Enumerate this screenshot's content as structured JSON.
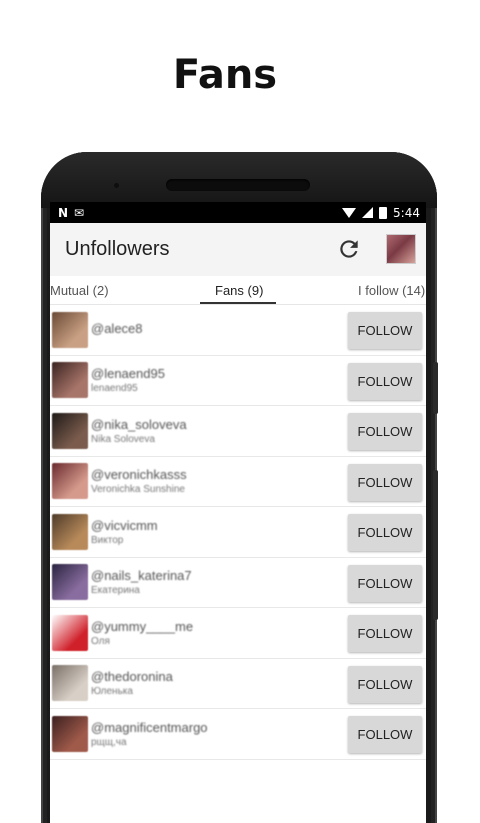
{
  "promo": {
    "title": "Fans"
  },
  "statusbar": {
    "left_icons": [
      "N",
      "✉"
    ],
    "time": "5:44"
  },
  "appbar": {
    "title": "Unfollowers",
    "refresh_icon": "refresh-icon"
  },
  "tabs": [
    {
      "label": "Mutual (2)",
      "selected": false
    },
    {
      "label": "Fans (9)",
      "selected": true
    },
    {
      "label": "I follow (14)",
      "selected": false
    }
  ],
  "follow_label": "FOLLOW",
  "users": [
    {
      "handle": "@alece8",
      "name": "",
      "avatar_colors": [
        "#6b4a36",
        "#c9a083"
      ]
    },
    {
      "handle": "@lenaend95",
      "name": "lenaend95",
      "avatar_colors": [
        "#3a2420",
        "#a8756a"
      ]
    },
    {
      "handle": "@nika_soloveva",
      "name": "Nika Soloveva",
      "avatar_colors": [
        "#1e1a18",
        "#7a5b4c"
      ]
    },
    {
      "handle": "@veronichkasss",
      "name": "Veronichka Sunshine",
      "avatar_colors": [
        "#6a2a2e",
        "#d69a8c"
      ]
    },
    {
      "handle": "@vicvicmm",
      "name": "Виктор",
      "avatar_colors": [
        "#4e3b2a",
        "#b88a5a"
      ]
    },
    {
      "handle": "@nails_katerina7",
      "name": "Екатерина",
      "avatar_colors": [
        "#2a2440",
        "#8a6da0"
      ]
    },
    {
      "handle": "@yummy____me",
      "name": "Оля",
      "avatar_colors": [
        "#ffffff",
        "#d0202a"
      ]
    },
    {
      "handle": "@thedoronina",
      "name": "Юленька",
      "avatar_colors": [
        "#7a7068",
        "#d8cfc6"
      ]
    },
    {
      "handle": "@magnificentmargo",
      "name": "рщщ,ча",
      "avatar_colors": [
        "#3c2020",
        "#a05a4a"
      ]
    }
  ]
}
